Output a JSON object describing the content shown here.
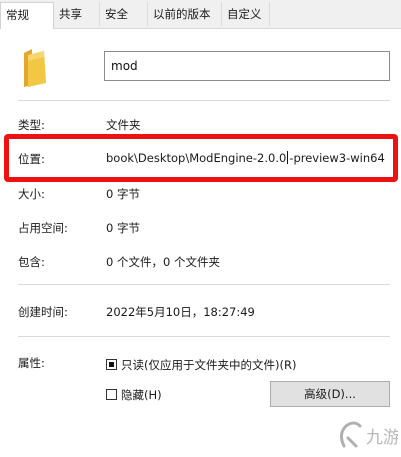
{
  "tabs": [
    "常规",
    "共享",
    "安全",
    "以前的版本",
    "自定义"
  ],
  "name_value": "mod",
  "fields": {
    "type_label": "类型:",
    "type_value": "文件夹",
    "location_label": "位置:",
    "location_value_a": "book\\Desktop\\ModEngine-2.0.0",
    "location_value_b": "-preview3-win64",
    "size_label": "大小:",
    "size_value": "0 字节",
    "disk_label": "占用空间:",
    "disk_value": "0 字节",
    "contains_label": "包含:",
    "contains_value": "0 个文件，0 个文件夹",
    "created_label": "创建时间:",
    "created_value": "2022年5月10日，18:27:49",
    "attr_label": "属性:"
  },
  "attributes": {
    "readonly_label": "只读(仅应用于文件夹中的文件)(R)",
    "readonly_state": "indeterminate",
    "hidden_label": "隐藏(H)",
    "hidden_checked": false,
    "advanced_button": "高级(D)..."
  },
  "watermark": "九游",
  "colors": {
    "highlight": "#ee1111",
    "folder": "#f2c744"
  }
}
